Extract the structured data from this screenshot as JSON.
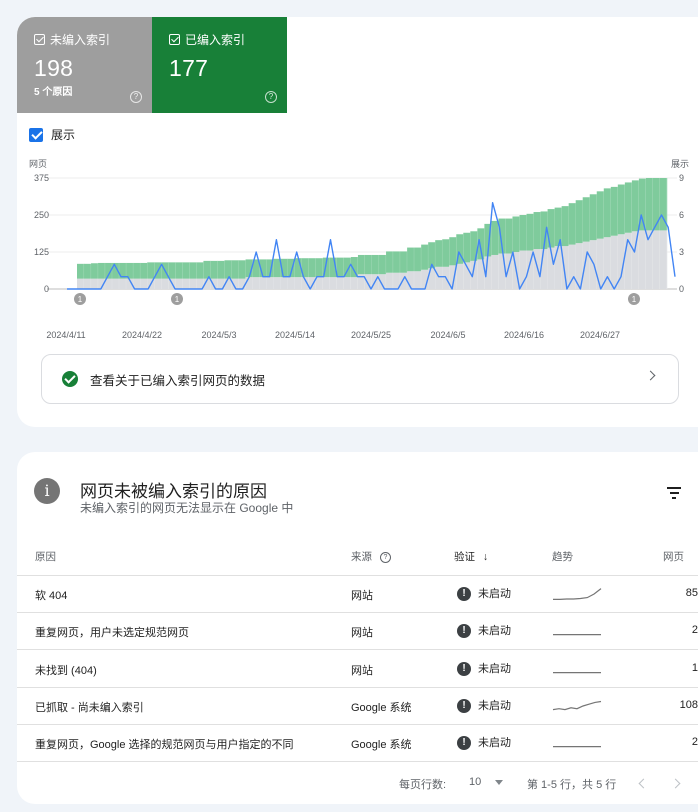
{
  "stats": {
    "unindexed": {
      "label": "未编入索引",
      "value": "198",
      "reasons": "5 个原因",
      "help": "?"
    },
    "indexed": {
      "label": "已编入索引",
      "value": "177",
      "help": "?"
    }
  },
  "show_impressions": {
    "label": "展示",
    "checked": true
  },
  "chart": {
    "left_axis_title": "网页",
    "right_axis_title": "展示",
    "left_ticks": [
      "375",
      "250",
      "125",
      "0"
    ],
    "right_ticks": [
      "9",
      "6",
      "3",
      "0"
    ],
    "x_ticks": [
      "2024/4/11",
      "2024/4/22",
      "2024/5/3",
      "2024/5/14",
      "2024/5/25",
      "2024/6/5",
      "2024/6/16",
      "2024/6/27"
    ],
    "annotation_label": "1",
    "colors": {
      "unindexed": "#dadce0",
      "indexed": "#7fcb9c",
      "impressions": "#4285f4"
    }
  },
  "chart_data": {
    "type": "bar",
    "title": "",
    "xlabel": "",
    "ylabel": "网页",
    "y2label": "展示",
    "ylim": [
      0,
      375
    ],
    "y2lim": [
      0,
      9
    ],
    "x_start": "2024/4/11",
    "x_end": "2024/7/3",
    "series": [
      {
        "name": "未编入索引",
        "values": [
          35,
          35,
          35,
          35,
          35,
          35,
          35,
          35,
          35,
          35,
          35,
          35,
          35,
          35,
          35,
          35,
          35,
          35,
          35,
          35,
          35,
          35,
          35,
          35,
          40,
          40,
          40,
          40,
          40,
          40,
          40,
          40,
          40,
          40,
          40,
          40,
          40,
          40,
          40,
          40,
          50,
          50,
          50,
          50,
          55,
          55,
          55,
          60,
          60,
          65,
          70,
          75,
          75,
          80,
          85,
          90,
          95,
          100,
          110,
          115,
          120,
          120,
          125,
          130,
          130,
          135,
          135,
          140,
          145,
          145,
          150,
          155,
          160,
          165,
          170,
          175,
          180,
          185,
          190,
          195,
          198,
          198,
          198,
          198
        ]
      },
      {
        "name": "已编入索引",
        "values": [
          50,
          50,
          52,
          53,
          53,
          53,
          53,
          53,
          53,
          53,
          55,
          55,
          55,
          55,
          55,
          55,
          55,
          55,
          60,
          60,
          60,
          62,
          62,
          62,
          60,
          60,
          60,
          60,
          62,
          62,
          62,
          64,
          64,
          64,
          64,
          66,
          66,
          66,
          66,
          68,
          65,
          65,
          65,
          65,
          72,
          72,
          72,
          80,
          80,
          85,
          88,
          90,
          93,
          95,
          100,
          100,
          100,
          105,
          110,
          115,
          118,
          118,
          120,
          120,
          124,
          125,
          127,
          130,
          130,
          135,
          140,
          145,
          150,
          155,
          160,
          165,
          165,
          168,
          170,
          172,
          175,
          177,
          177,
          177
        ]
      }
    ],
    "impressions": [
      0,
      0,
      0,
      0,
      0,
      0,
      1,
      2,
      1,
      1,
      0,
      0,
      0,
      1,
      2,
      1,
      0,
      0,
      0,
      0,
      0,
      1,
      0,
      0,
      1,
      0,
      0,
      1,
      3,
      1,
      1,
      4,
      1,
      1,
      3,
      1,
      0,
      1,
      1,
      4,
      1,
      1,
      2,
      1,
      1,
      0,
      1,
      0,
      0,
      0,
      1,
      0,
      0,
      0,
      2,
      1,
      1,
      0,
      3,
      2,
      1,
      4,
      1,
      7,
      5,
      1,
      3,
      0,
      1,
      3,
      1,
      5,
      2,
      4,
      0,
      1,
      0,
      3,
      2,
      0,
      1,
      0,
      1,
      4,
      3,
      6,
      4,
      5,
      6,
      5,
      1
    ]
  },
  "link_row": {
    "label": "查看关于已编入索引网页的数据"
  },
  "table": {
    "title": "网页未被编入索引的原因",
    "subtitle": "未编入索引的网页无法显示在 Google 中",
    "columns": {
      "reason": "原因",
      "source": "来源",
      "validation": "验证",
      "trend": "趋势",
      "pages": "网页"
    },
    "rows": [
      {
        "reason": "软 404",
        "source": "网站",
        "status": "未启动",
        "pages": "85",
        "trend": [
          0.2,
          0.2,
          0.22,
          0.22,
          0.25,
          0.3,
          0.5,
          0.8
        ]
      },
      {
        "reason": "重复网页，用户未选定规范网页",
        "source": "网站",
        "status": "未启动",
        "pages": "2",
        "trend": [
          0.3,
          0.3,
          0.3,
          0.3,
          0.3,
          0.3,
          0.3,
          0.3
        ]
      },
      {
        "reason": "未找到 (404)",
        "source": "网站",
        "status": "未启动",
        "pages": "1",
        "trend": [
          0.3,
          0.3,
          0.3,
          0.3,
          0.3,
          0.3,
          0.3,
          0.3
        ]
      },
      {
        "reason": "已抓取 - 尚未编入索引",
        "source": "Google 系统",
        "status": "未启动",
        "pages": "108",
        "trend": [
          0.3,
          0.35,
          0.3,
          0.4,
          0.35,
          0.5,
          0.6,
          0.7,
          0.75
        ]
      },
      {
        "reason": "重复网页，Google 选择的规范网页与用户指定的不同",
        "source": "Google 系统",
        "status": "未启动",
        "pages": "2",
        "trend": [
          0.3,
          0.3,
          0.3,
          0.3,
          0.3,
          0.3,
          0.3,
          0.3
        ]
      }
    ],
    "pager": {
      "rows_per_page_label": "每页行数:",
      "rows_per_page": "10",
      "range_text": "第 1-5 行，共 5 行"
    }
  }
}
